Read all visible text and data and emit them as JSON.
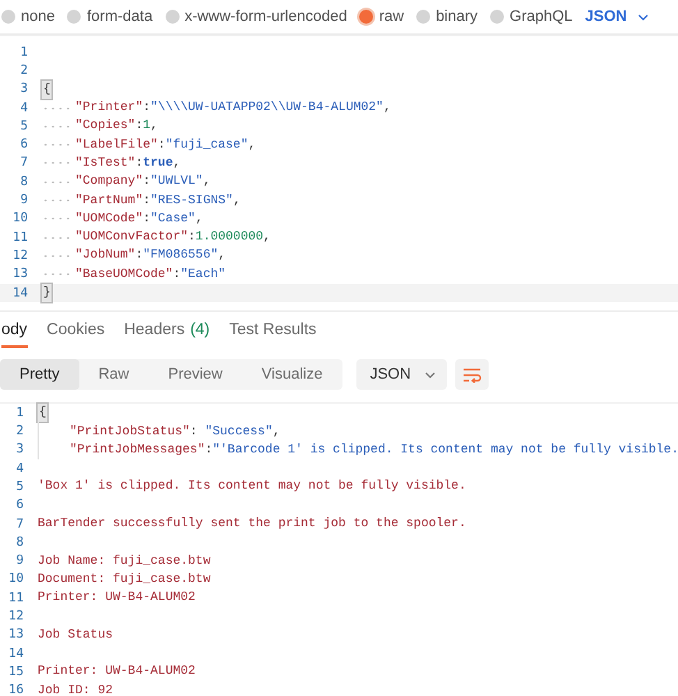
{
  "body_types": [
    {
      "label": "none",
      "selected": false
    },
    {
      "label": "form-data",
      "selected": false
    },
    {
      "label": "x-www-form-urlencoded",
      "selected": false
    },
    {
      "label": "raw",
      "selected": true
    },
    {
      "label": "binary",
      "selected": false
    },
    {
      "label": "GraphQL",
      "selected": false
    }
  ],
  "body_format": "JSON",
  "request_editor": {
    "lines": [
      {
        "number": "1",
        "kind": "plain"
      },
      {
        "number": "2",
        "kind": "plain"
      },
      {
        "number": "3",
        "kind": "plain",
        "tokens": [
          {
            "kind": "brace",
            "text": "{"
          }
        ]
      },
      {
        "number": "4",
        "kind": "dotted",
        "tokens": [
          {
            "kind": "key",
            "text": "\"Printer\""
          },
          {
            "kind": "punct",
            "text": ":"
          },
          {
            "kind": "string",
            "text": "\"\\\\\\\\UW-UATAPP02\\\\UW-B4-ALUM02\""
          },
          {
            "kind": "punct",
            "text": ","
          }
        ]
      },
      {
        "number": "5",
        "kind": "dotted",
        "tokens": [
          {
            "kind": "key",
            "text": "\"Copies\""
          },
          {
            "kind": "punct",
            "text": ":"
          },
          {
            "kind": "number",
            "text": "1"
          },
          {
            "kind": "punct",
            "text": ","
          }
        ]
      },
      {
        "number": "6",
        "kind": "dotted",
        "tokens": [
          {
            "kind": "key",
            "text": "\"LabelFile\""
          },
          {
            "kind": "punct",
            "text": ":"
          },
          {
            "kind": "string",
            "text": "\"fuji_case\""
          },
          {
            "kind": "punct",
            "text": ","
          }
        ]
      },
      {
        "number": "7",
        "kind": "dotted",
        "tokens": [
          {
            "kind": "key",
            "text": "\"IsTest\""
          },
          {
            "kind": "punct",
            "text": ":"
          },
          {
            "kind": "bool",
            "text": "true"
          },
          {
            "kind": "punct",
            "text": ","
          }
        ]
      },
      {
        "number": "8",
        "kind": "dotted",
        "tokens": [
          {
            "kind": "key",
            "text": "\"Company\""
          },
          {
            "kind": "punct",
            "text": ":"
          },
          {
            "kind": "string",
            "text": "\"UWLVL\""
          },
          {
            "kind": "punct",
            "text": ","
          }
        ]
      },
      {
        "number": "9",
        "kind": "dotted",
        "tokens": [
          {
            "kind": "key",
            "text": "\"PartNum\""
          },
          {
            "kind": "punct",
            "text": ":"
          },
          {
            "kind": "string",
            "text": "\"RES-SIGNS\""
          },
          {
            "kind": "punct",
            "text": ","
          }
        ]
      },
      {
        "number": "10",
        "kind": "dotted",
        "tokens": [
          {
            "kind": "key",
            "text": "\"UOMCode\""
          },
          {
            "kind": "punct",
            "text": ":"
          },
          {
            "kind": "string",
            "text": "\"Case\""
          },
          {
            "kind": "punct",
            "text": ","
          }
        ]
      },
      {
        "number": "11",
        "kind": "dotted",
        "tokens": [
          {
            "kind": "key",
            "text": "\"UOMConvFactor\""
          },
          {
            "kind": "punct",
            "text": ":"
          },
          {
            "kind": "number",
            "text": "1.0000000"
          },
          {
            "kind": "punct",
            "text": ","
          }
        ]
      },
      {
        "number": "12",
        "kind": "dotted",
        "tokens": [
          {
            "kind": "key",
            "text": "\"JobNum\""
          },
          {
            "kind": "punct",
            "text": ":"
          },
          {
            "kind": "string",
            "text": "\"FM086556\""
          },
          {
            "kind": "punct",
            "text": ","
          }
        ]
      },
      {
        "number": "13",
        "kind": "dotted",
        "tokens": [
          {
            "kind": "key",
            "text": "\"BaseUOMCode\""
          },
          {
            "kind": "punct",
            "text": ":"
          },
          {
            "kind": "string",
            "text": "\"Each\""
          }
        ]
      },
      {
        "number": "14",
        "kind": "plain",
        "current": true,
        "tokens": [
          {
            "kind": "brace",
            "text": "}"
          }
        ]
      }
    ]
  },
  "response_tabs": [
    {
      "label": "ody",
      "selected": true
    },
    {
      "label": "Cookies",
      "selected": false
    },
    {
      "label": "Headers",
      "count": "(4)",
      "selected": false
    },
    {
      "label": "Test Results",
      "selected": false
    }
  ],
  "view_modes": [
    {
      "label": "Pretty",
      "selected": true
    },
    {
      "label": "Raw",
      "selected": false
    },
    {
      "label": "Preview",
      "selected": false
    },
    {
      "label": "Visualize",
      "selected": false
    }
  ],
  "response_format": "JSON",
  "response_editor": {
    "lines": [
      {
        "number": "1",
        "kind": "plain",
        "tokens": [
          {
            "kind": "brace",
            "text": "{"
          }
        ]
      },
      {
        "number": "2",
        "kind": "nested",
        "tokens": [
          {
            "kind": "key",
            "text": "\"PrintJobStatus\""
          },
          {
            "kind": "punct",
            "text": ": "
          },
          {
            "kind": "string",
            "text": "\"Success\""
          },
          {
            "kind": "punct",
            "text": ","
          }
        ]
      },
      {
        "number": "3",
        "kind": "nested",
        "tokens": [
          {
            "kind": "key",
            "text": "\"PrintJobMessages\""
          },
          {
            "kind": "punct",
            "text": ":"
          },
          {
            "kind": "string",
            "text": "\"'Barcode 1' is clipped. Its content may not be fully visible."
          }
        ]
      },
      {
        "number": "4",
        "kind": "plain"
      },
      {
        "number": "5",
        "kind": "plain",
        "tokens": [
          {
            "kind": "text",
            "text": "'Box 1' is clipped. Its content may not be fully visible."
          }
        ]
      },
      {
        "number": "6",
        "kind": "plain"
      },
      {
        "number": "7",
        "kind": "plain",
        "tokens": [
          {
            "kind": "text",
            "text": "BarTender successfully sent the print job to the spooler."
          }
        ]
      },
      {
        "number": "8",
        "kind": "plain"
      },
      {
        "number": "9",
        "kind": "plain",
        "tokens": [
          {
            "kind": "text",
            "text": "Job Name: fuji_case.btw"
          }
        ]
      },
      {
        "number": "10",
        "kind": "plain",
        "tokens": [
          {
            "kind": "text",
            "text": "Document: fuji_case.btw"
          }
        ]
      },
      {
        "number": "11",
        "kind": "plain",
        "tokens": [
          {
            "kind": "text",
            "text": "Printer: UW-B4-ALUM02"
          }
        ]
      },
      {
        "number": "12",
        "kind": "plain"
      },
      {
        "number": "13",
        "kind": "plain",
        "tokens": [
          {
            "kind": "text",
            "text": "Job Status"
          }
        ]
      },
      {
        "number": "14",
        "kind": "plain"
      },
      {
        "number": "15",
        "kind": "plain",
        "tokens": [
          {
            "kind": "text",
            "text": "Printer: UW-B4-ALUM02"
          }
        ]
      },
      {
        "number": "16",
        "kind": "plain",
        "tokens": [
          {
            "kind": "text",
            "text": "Job ID: 92"
          }
        ]
      }
    ]
  }
}
